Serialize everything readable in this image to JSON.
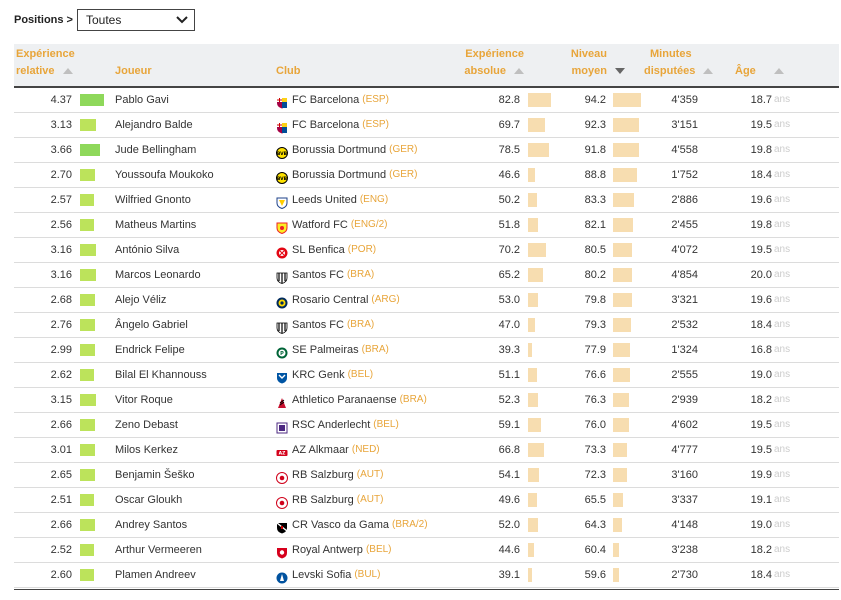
{
  "filter": {
    "label": "Positions >",
    "selected": "Toutes"
  },
  "headers": {
    "relative_line1": "Expérience",
    "relative_line2": "relative",
    "player": "Joueur",
    "club": "Club",
    "absolute_line1": "Expérience",
    "absolute_line2": "absolue",
    "level_line1": "Niveau",
    "level_line2": "moyen",
    "minutes_line1": "Minutes",
    "minutes_line2": "disputées",
    "age": "Âge"
  },
  "colors": {
    "accent": "#e8a53a",
    "bar_green_dark": "#8ed85a",
    "bar_green_light": "#bce35b",
    "bar_beige": "#f7ddb0"
  },
  "rows": [
    {
      "rel": "4.37",
      "rel_frac": 1.0,
      "player": "Pablo Gavi",
      "club": "FC Barcelona",
      "country": "(ESP)",
      "crest": "barca",
      "abs": "82.8",
      "niv": "94.2",
      "min": "4'359",
      "age": "18.7",
      "ans": "ans"
    },
    {
      "rel": "3.13",
      "rel_frac": 0.65,
      "player": "Alejandro Balde",
      "club": "FC Barcelona",
      "country": "(ESP)",
      "crest": "barca",
      "abs": "69.7",
      "niv": "92.3",
      "min": "3'151",
      "age": "19.5",
      "ans": "ans"
    },
    {
      "rel": "3.66",
      "rel_frac": 0.83,
      "player": "Jude Bellingham",
      "club": "Borussia Dortmund",
      "country": "(GER)",
      "crest": "bvb",
      "abs": "78.5",
      "niv": "91.8",
      "min": "4'558",
      "age": "19.8",
      "ans": "ans"
    },
    {
      "rel": "2.70",
      "rel_frac": 0.62,
      "player": "Youssoufa Moukoko",
      "club": "Borussia Dortmund",
      "country": "(GER)",
      "crest": "bvb",
      "abs": "46.6",
      "niv": "88.8",
      "min": "1'752",
      "age": "18.4",
      "ans": "ans"
    },
    {
      "rel": "2.57",
      "rel_frac": 0.6,
      "player": "Wilfried Gnonto",
      "club": "Leeds United",
      "country": "(ENG)",
      "crest": "leeds",
      "abs": "50.2",
      "niv": "83.3",
      "min": "2'886",
      "age": "19.6",
      "ans": "ans"
    },
    {
      "rel": "2.56",
      "rel_frac": 0.6,
      "player": "Matheus Martins",
      "club": "Watford FC",
      "country": "(ENG/2)",
      "crest": "watford",
      "abs": "51.8",
      "niv": "82.1",
      "min": "2'455",
      "age": "19.8",
      "ans": "ans"
    },
    {
      "rel": "3.16",
      "rel_frac": 0.65,
      "player": "António Silva",
      "club": "SL Benfica",
      "country": "(POR)",
      "crest": "benfica",
      "abs": "70.2",
      "niv": "80.5",
      "min": "4'072",
      "age": "19.5",
      "ans": "ans"
    },
    {
      "rel": "3.16",
      "rel_frac": 0.65,
      "player": "Marcos Leonardo",
      "club": "Santos FC",
      "country": "(BRA)",
      "crest": "santos",
      "abs": "65.2",
      "niv": "80.2",
      "min": "4'854",
      "age": "20.0",
      "ans": "ans"
    },
    {
      "rel": "2.68",
      "rel_frac": 0.62,
      "player": "Alejo Véliz",
      "club": "Rosario Central",
      "country": "(ARG)",
      "crest": "rosario",
      "abs": "53.0",
      "niv": "79.8",
      "min": "3'321",
      "age": "19.6",
      "ans": "ans"
    },
    {
      "rel": "2.76",
      "rel_frac": 0.62,
      "player": "Ângelo Gabriel",
      "club": "Santos FC",
      "country": "(BRA)",
      "crest": "santos",
      "abs": "47.0",
      "niv": "79.3",
      "min": "2'532",
      "age": "18.4",
      "ans": "ans"
    },
    {
      "rel": "2.99",
      "rel_frac": 0.64,
      "player": "Endrick Felipe",
      "club": "SE Palmeiras",
      "country": "(BRA)",
      "crest": "palmeiras",
      "abs": "39.3",
      "niv": "77.9",
      "min": "1'324",
      "age": "16.8",
      "ans": "ans"
    },
    {
      "rel": "2.62",
      "rel_frac": 0.6,
      "player": "Bilal El Khannouss",
      "club": "KRC Genk",
      "country": "(BEL)",
      "crest": "genk",
      "abs": "51.1",
      "niv": "76.6",
      "min": "2'555",
      "age": "19.0",
      "ans": "ans"
    },
    {
      "rel": "3.15",
      "rel_frac": 0.65,
      "player": "Vitor Roque",
      "club": "Athletico Paranaense",
      "country": "(BRA)",
      "crest": "athletico",
      "abs": "52.3",
      "niv": "76.3",
      "min": "2'939",
      "age": "18.2",
      "ans": "ans"
    },
    {
      "rel": "2.66",
      "rel_frac": 0.62,
      "player": "Zeno Debast",
      "club": "RSC Anderlecht",
      "country": "(BEL)",
      "crest": "anderlecht",
      "abs": "59.1",
      "niv": "76.0",
      "min": "4'602",
      "age": "19.5",
      "ans": "ans"
    },
    {
      "rel": "3.01",
      "rel_frac": 0.64,
      "player": "Milos Kerkez",
      "club": "AZ Alkmaar",
      "country": "(NED)",
      "crest": "az",
      "abs": "66.8",
      "niv": "73.3",
      "min": "4'777",
      "age": "19.5",
      "ans": "ans"
    },
    {
      "rel": "2.65",
      "rel_frac": 0.62,
      "player": "Benjamin Šeško",
      "club": "RB Salzburg",
      "country": "(AUT)",
      "crest": "salzburg",
      "abs": "54.1",
      "niv": "72.3",
      "min": "3'160",
      "age": "19.9",
      "ans": "ans"
    },
    {
      "rel": "2.51",
      "rel_frac": 0.6,
      "player": "Oscar Gloukh",
      "club": "RB Salzburg",
      "country": "(AUT)",
      "crest": "salzburg",
      "abs": "49.6",
      "niv": "65.5",
      "min": "3'337",
      "age": "19.1",
      "ans": "ans"
    },
    {
      "rel": "2.66",
      "rel_frac": 0.62,
      "player": "Andrey Santos",
      "club": "CR Vasco da Gama",
      "country": "(BRA/2)",
      "crest": "vasco",
      "abs": "52.0",
      "niv": "64.3",
      "min": "4'148",
      "age": "19.0",
      "ans": "ans"
    },
    {
      "rel": "2.52",
      "rel_frac": 0.6,
      "player": "Arthur Vermeeren",
      "club": "Royal Antwerp",
      "country": "(BEL)",
      "crest": "antwerp",
      "abs": "44.6",
      "niv": "60.4",
      "min": "3'238",
      "age": "18.2",
      "ans": "ans"
    },
    {
      "rel": "2.60",
      "rel_frac": 0.6,
      "player": "Plamen Andreev",
      "club": "Levski Sofia",
      "country": "(BUL)",
      "crest": "levski",
      "abs": "39.1",
      "niv": "59.6",
      "min": "2'730",
      "age": "18.4",
      "ans": "ans"
    }
  ]
}
